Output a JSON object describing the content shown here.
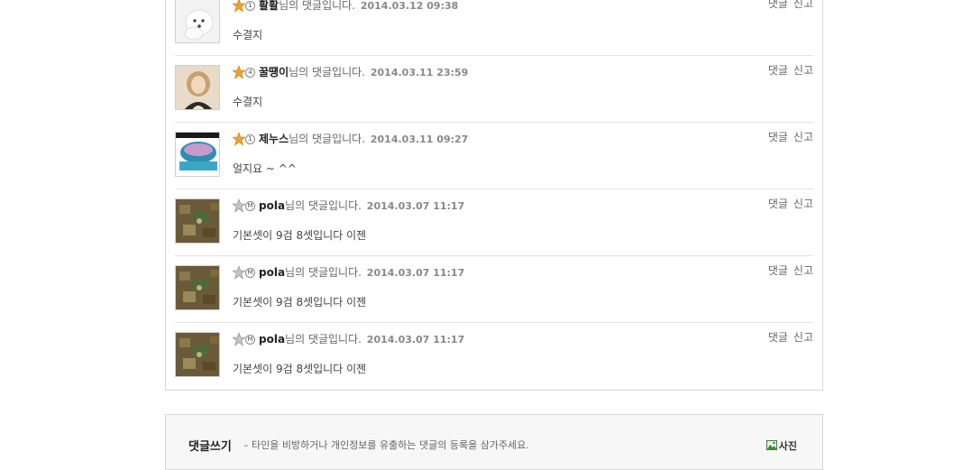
{
  "comments": [
    {
      "nickname": "활활",
      "suffix": "님의 댓글입니다.",
      "date": "2014.03.12 09:38",
      "text": "수결지",
      "level": "1",
      "star": "gold",
      "avatar": "dog"
    },
    {
      "nickname": "꿀떙이",
      "suffix": "님의 댓글입니다.",
      "date": "2014.03.11 23:59",
      "text": "수결지",
      "level": "4",
      "star": "gold",
      "avatar": "woman"
    },
    {
      "nickname": "제누스",
      "suffix": "님의 댓글입니다.",
      "date": "2014.03.11 09:27",
      "text": "얼지요 ~ ^^",
      "level": "1",
      "star": "gold",
      "avatar": "cup"
    },
    {
      "nickname": "pola",
      "suffix": "님의 댓글입니다.",
      "date": "2014.03.07 11:17",
      "text": "기본셋이 9검 8셋입니다 이젠",
      "level": "M",
      "star": "silver",
      "avatar": "game"
    },
    {
      "nickname": "pola",
      "suffix": "님의 댓글입니다.",
      "date": "2014.03.07 11:17",
      "text": "기본셋이 9검 8셋입니다 이젠",
      "level": "M",
      "star": "silver",
      "avatar": "game"
    },
    {
      "nickname": "pola",
      "suffix": "님의 댓글입니다.",
      "date": "2014.03.07 11:17",
      "text": "기본셋이 9검 8셋입니다 이젠",
      "level": "M",
      "star": "silver",
      "avatar": "game"
    }
  ],
  "actions": {
    "reply": "댓글",
    "report": "신고"
  },
  "write": {
    "title": "댓글쓰기",
    "notice": "– 타인을 비방하거나 개인정보를 유출하는 댓글의 등록을 삼가주세요.",
    "photo_label": "사진"
  },
  "colors": {
    "gold_star": "#f0a030",
    "silver_star": "#b8b8b8",
    "border": "#d6d6d6"
  }
}
